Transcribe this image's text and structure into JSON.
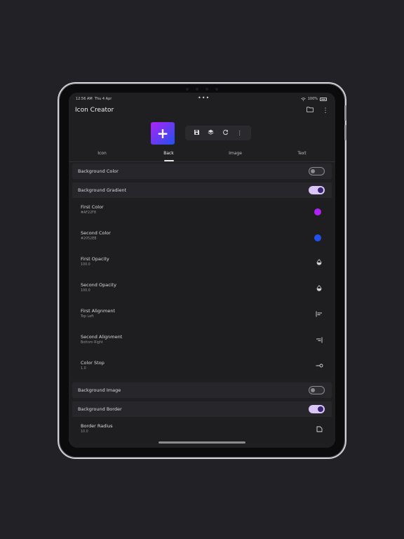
{
  "status": {
    "time": "12:56 AM",
    "date": "Thu 4 Apr",
    "battery": "100%"
  },
  "app": {
    "title": "Icon Creator"
  },
  "tabs": [
    {
      "label": "Icon",
      "active": false
    },
    {
      "label": "Back",
      "active": true
    },
    {
      "label": "Image",
      "active": false
    },
    {
      "label": "Text",
      "active": false
    }
  ],
  "preview": {
    "symbol": "+"
  },
  "colors": {
    "first": "#AF22F8",
    "second": "#2052EB",
    "accent": "#3a2475",
    "toggle_on": "#d9c6f7"
  },
  "settings": {
    "background_color": {
      "label": "Background Color",
      "enabled": false
    },
    "background_gradient": {
      "label": "Background Gradient",
      "enabled": true
    },
    "first_color": {
      "label": "First Color",
      "value": "#AF22F8"
    },
    "second_color": {
      "label": "Second Color",
      "value": "#2052EB"
    },
    "first_opacity": {
      "label": "First Opacity",
      "value": "100.0"
    },
    "second_opacity": {
      "label": "Second Opacity",
      "value": "100.0"
    },
    "first_alignment": {
      "label": "First Alignment",
      "value": "Top Left"
    },
    "second_alignment": {
      "label": "Second Alignment",
      "value": "Bottom Right"
    },
    "color_stop": {
      "label": "Color Stop",
      "value": "1.0"
    },
    "background_image": {
      "label": "Background Image",
      "enabled": false
    },
    "background_border": {
      "label": "Background Border",
      "enabled": true
    },
    "border_radius": {
      "label": "Border Radius",
      "value": "10.0"
    }
  },
  "icons": {
    "folder": "folder-icon",
    "more": "more-vert-icon",
    "save": "save-icon",
    "layers": "layers-icon",
    "refresh": "refresh-icon",
    "opacity": "opacity-icon",
    "align_left": "align-left-icon",
    "align_right": "align-right-icon",
    "stop": "color-stop-icon",
    "radius": "border-radius-icon",
    "wifi": "wifi-icon"
  }
}
